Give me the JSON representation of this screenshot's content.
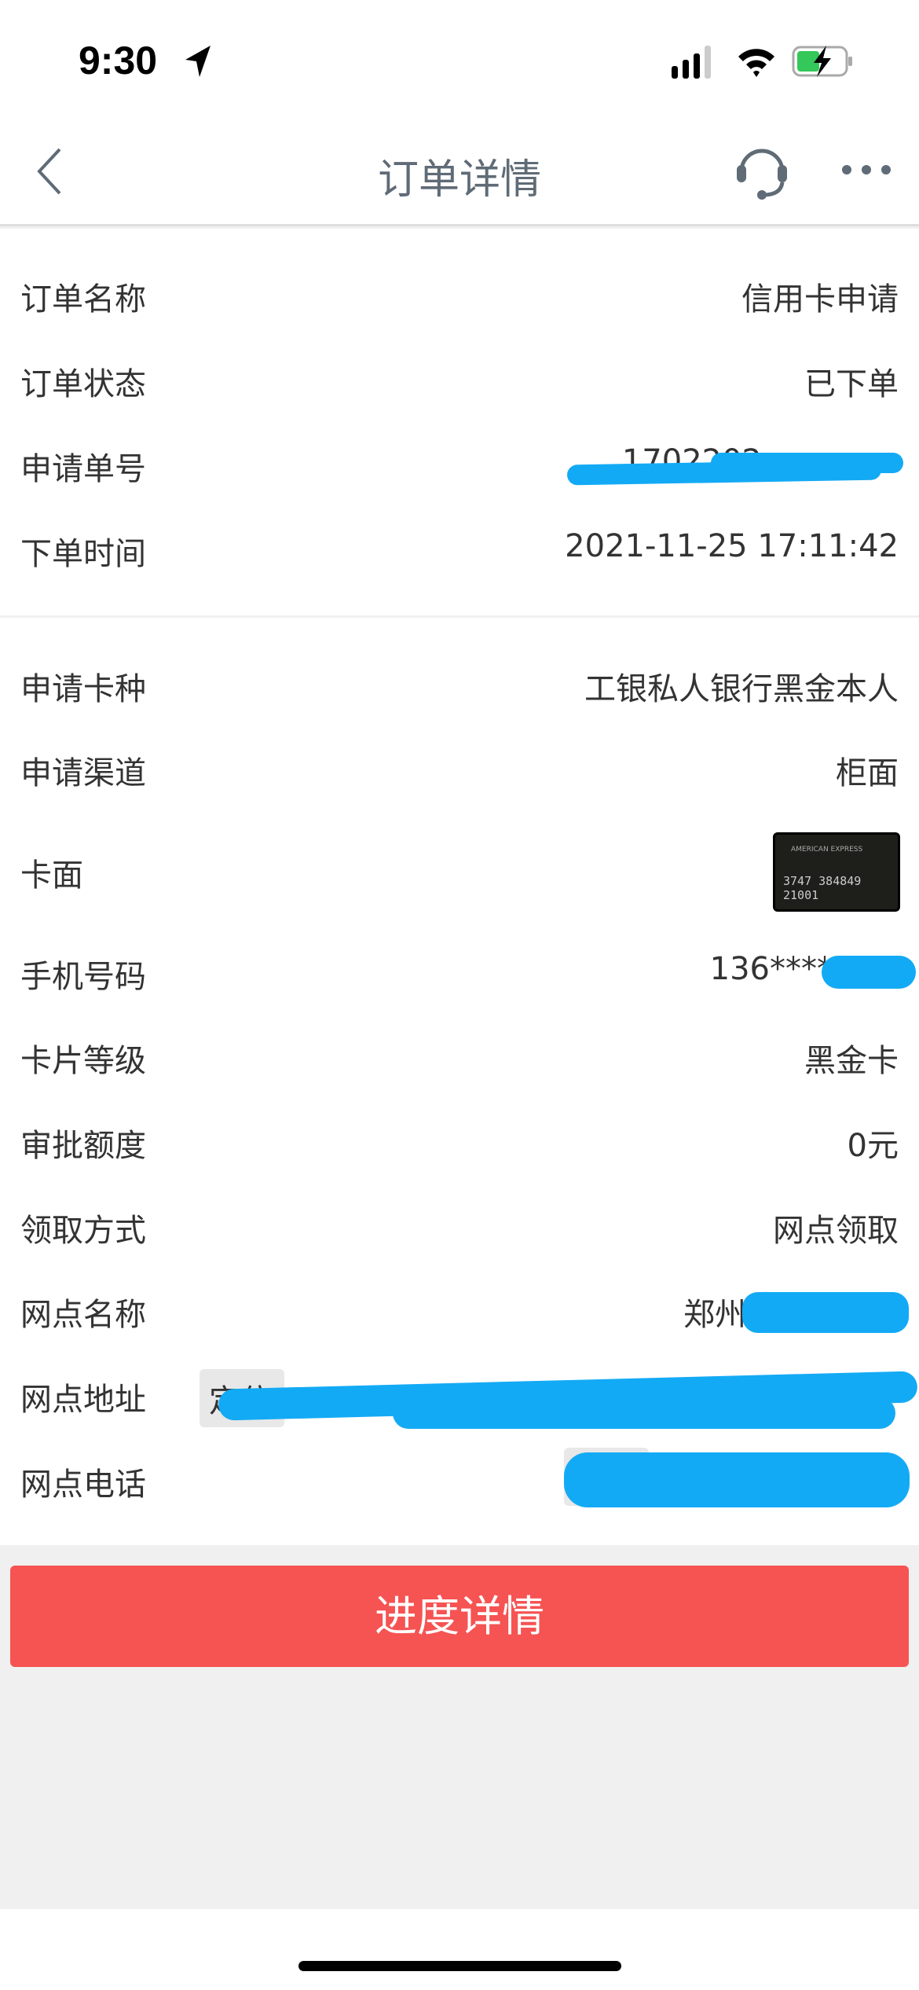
{
  "status_bar": {
    "time": "9:30"
  },
  "nav": {
    "title": "订单详情",
    "icons": [
      "back-chevron-icon",
      "customer-service-headset-icon",
      "more-icon"
    ]
  },
  "order": [
    {
      "label": "订单名称",
      "value": "信用卡申请"
    },
    {
      "label": "订单状态",
      "value": "已下单"
    },
    {
      "label": "申请单号",
      "value": "1702202"
    },
    {
      "label": "下单时间",
      "value": "2021-11-25 17:11:42"
    }
  ],
  "details": {
    "card_type": {
      "label": "申请卡种",
      "value": "工银私人银行黑金本人"
    },
    "channel": {
      "label": "申请渠道",
      "value": "柜面"
    },
    "card_face": {
      "label": "卡面",
      "card_text": "AMERICAN EXPRESS",
      "card_number": "3747 384849 21001"
    },
    "phone": {
      "label": "手机号码",
      "value": "136****"
    },
    "level": {
      "label": "卡片等级",
      "value": "黑金卡"
    },
    "limit": {
      "label": "审批额度",
      "value": "0元"
    },
    "pickup": {
      "label": "领取方式",
      "value": "网点领取"
    },
    "branch_name": {
      "label": "网点名称",
      "value": "郑州市"
    },
    "branch_address": {
      "label": "网点地址",
      "chip": "定位"
    },
    "branch_phone": {
      "label": "网点电话"
    }
  },
  "button": {
    "label": "进度详情"
  },
  "colors": {
    "accent": "#f65353",
    "redaction": "#13aaf5",
    "title": "#5f6b76"
  }
}
